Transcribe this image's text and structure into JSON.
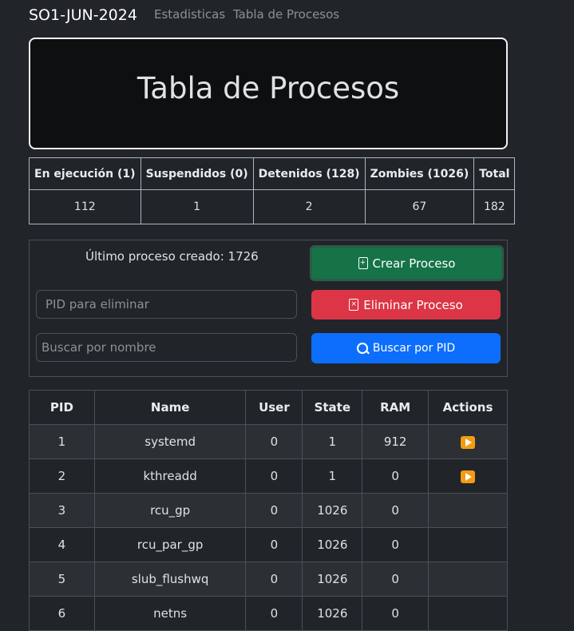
{
  "nav": {
    "brand": "SO1-JUN-2024",
    "links": [
      "Estadisticas",
      "Tabla de Procesos"
    ]
  },
  "hero": {
    "title": "Tabla de Procesos"
  },
  "summary": {
    "headers": [
      "En ejecución (1)",
      "Suspendidos (0)",
      "Detenidos (128)",
      "Zombies (1026)",
      "Total"
    ],
    "values": [
      "112",
      "1",
      "2",
      "67",
      "182"
    ]
  },
  "panel": {
    "last_created": "Último proceso creado: 1726",
    "create_label": "Crear Proceso",
    "delete_label": "Eliminar Proceso",
    "search_label": "Buscar por PID",
    "pid_placeholder": "PID para eliminar",
    "name_placeholder": "Buscar por nombre",
    "colors": {
      "create": "#157347",
      "delete": "#dc3545",
      "search": "#0d6efd"
    }
  },
  "table": {
    "headers": [
      "PID",
      "Name",
      "User",
      "State",
      "RAM",
      "Actions"
    ],
    "rows": [
      {
        "pid": "1",
        "name": "systemd",
        "user": "0",
        "state": "1",
        "ram": "912",
        "action": "play-icon"
      },
      {
        "pid": "2",
        "name": "kthreadd",
        "user": "0",
        "state": "1",
        "ram": "0",
        "action": "play-icon"
      },
      {
        "pid": "3",
        "name": "rcu_gp",
        "user": "0",
        "state": "1026",
        "ram": "0",
        "action": ""
      },
      {
        "pid": "4",
        "name": "rcu_par_gp",
        "user": "0",
        "state": "1026",
        "ram": "0",
        "action": ""
      },
      {
        "pid": "5",
        "name": "slub_flushwq",
        "user": "0",
        "state": "1026",
        "ram": "0",
        "action": ""
      },
      {
        "pid": "6",
        "name": "netns",
        "user": "0",
        "state": "1026",
        "ram": "0",
        "action": ""
      }
    ]
  }
}
